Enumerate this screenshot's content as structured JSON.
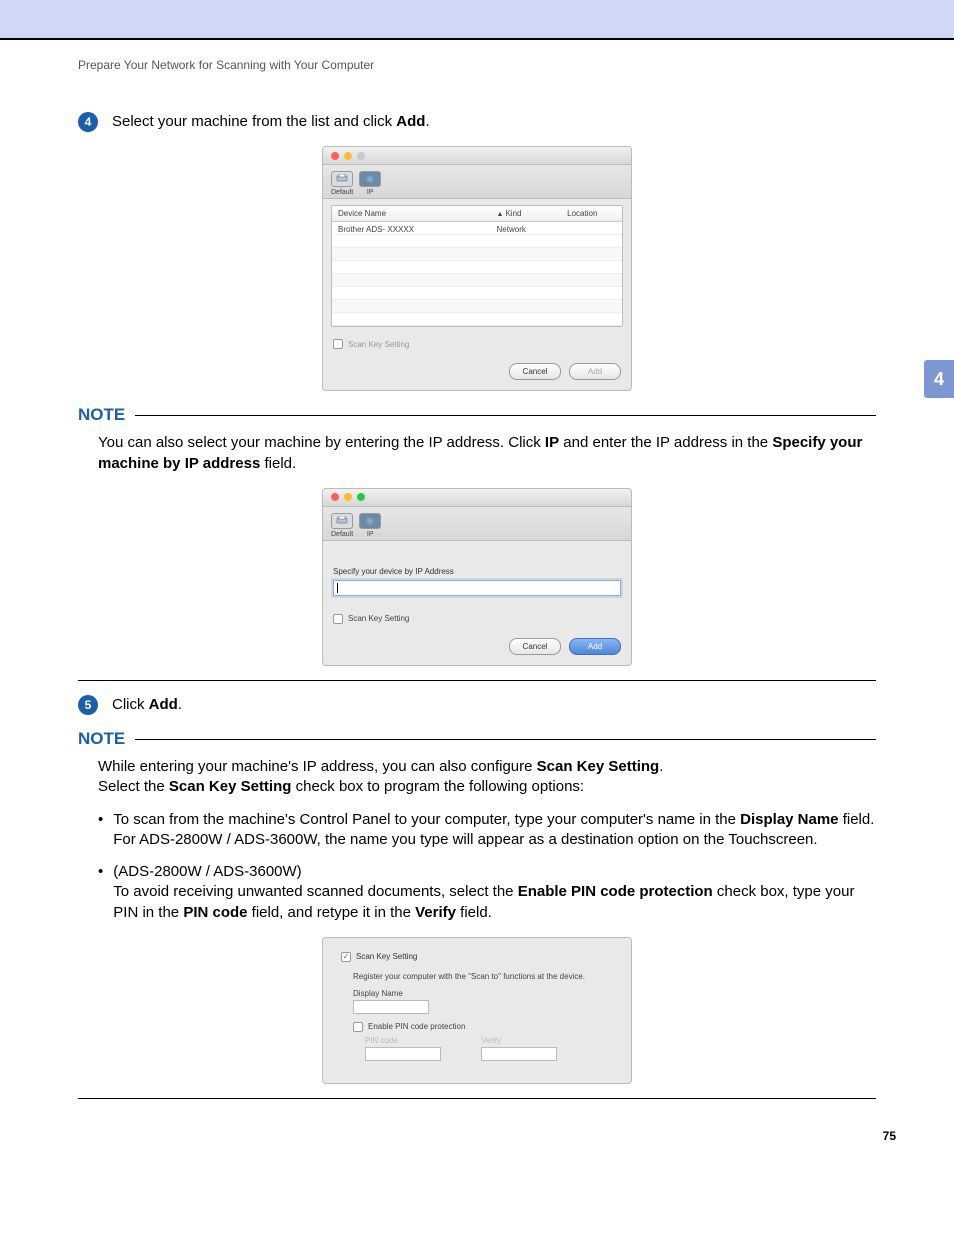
{
  "header": "Prepare Your Network for Scanning with Your Computer",
  "side_tab": "4",
  "page_number": "75",
  "step4": {
    "num": "4",
    "pre": "Select your machine from the list and click ",
    "bold": "Add",
    "post": "."
  },
  "dlg1": {
    "tab_default": "Default",
    "tab_ip": "IP",
    "col_name": "Device Name",
    "col_kind": "Kind",
    "col_loc": "Location",
    "row_name": "Brother ADS- XXXXX",
    "row_kind": "Network",
    "sks": "Scan Key Setting",
    "cancel": "Cancel",
    "add": "Add"
  },
  "note1": {
    "label": "NOTE",
    "t1": "You can also select your machine by entering the IP address. Click ",
    "b1": "IP",
    "t2": " and enter the IP address in the ",
    "b2": "Specify your machine by IP address",
    "t3": " field."
  },
  "dlg2": {
    "tab_default": "Default",
    "tab_ip": "IP",
    "label": "Specify your device by IP Address",
    "sks": "Scan Key Setting",
    "cancel": "Cancel",
    "add": "Add"
  },
  "step5": {
    "num": "5",
    "pre": "Click ",
    "bold": "Add",
    "post": "."
  },
  "note2": {
    "label": "NOTE",
    "l1a": "While entering your machine's IP address, you can also configure ",
    "l1b": "Scan Key Setting",
    "l1c": ".",
    "l2a": "Select the ",
    "l2b": "Scan Key Setting",
    "l2c": " check box to program the following options:",
    "b1a": "To scan from the machine's Control Panel to your computer, type your computer's name in the ",
    "b1b": "Display Name",
    "b1c": " field. For ADS-2800W / ADS-3600W, the name you type will appear as a destination option on the Touchscreen.",
    "b2a": "(ADS-2800W / ADS-3600W)",
    "b2b": "To avoid receiving unwanted scanned documents, select the ",
    "b2c": "Enable PIN code protection",
    "b2d": " check box, type your PIN in the ",
    "b2e": "PIN code",
    "b2f": " field, and retype it in the ",
    "b2g": "Verify",
    "b2h": " field."
  },
  "dlg3": {
    "sks": "Scan Key Setting",
    "reg": "Register your computer with the \"Scan to\" functions at the device.",
    "dname": "Display Name",
    "enable_pin": "Enable PIN code protection",
    "pin": "PIN code",
    "verify": "Verify"
  }
}
